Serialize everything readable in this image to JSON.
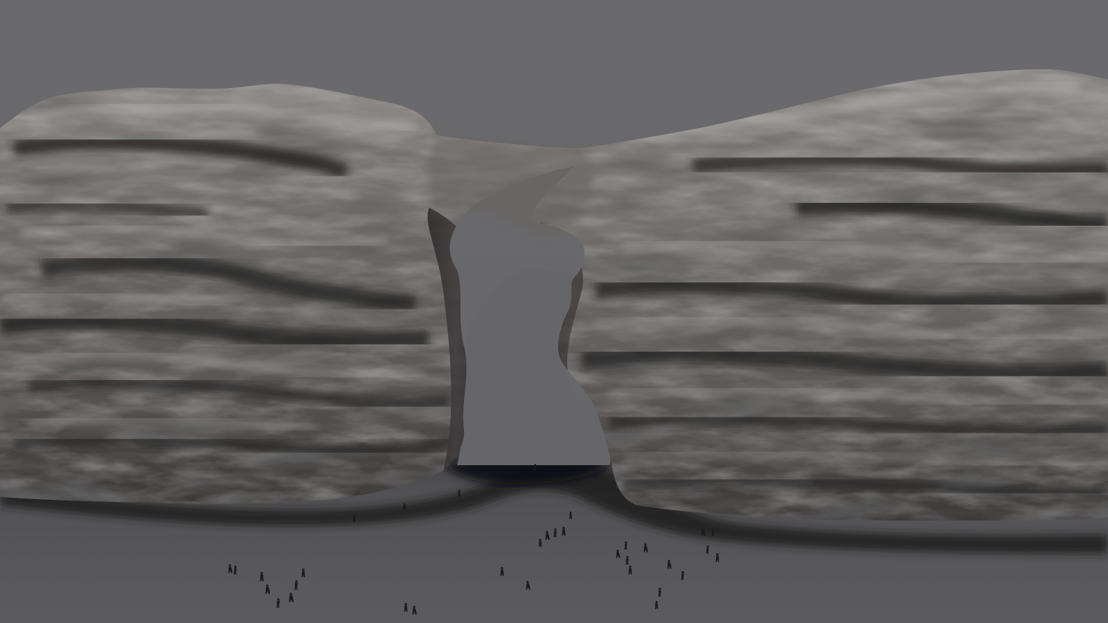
{
  "scene": {
    "subject": "rock-arch",
    "colors": {
      "background": "#6b6b6d",
      "ground": "#545456",
      "rock_light": "#9a9896",
      "rock_mid": "#6f6c6a",
      "rock_dark": "#2c2a2a",
      "shadow": "#1e1e20",
      "figures": "#1c1c1e"
    },
    "figure_count": 44
  }
}
